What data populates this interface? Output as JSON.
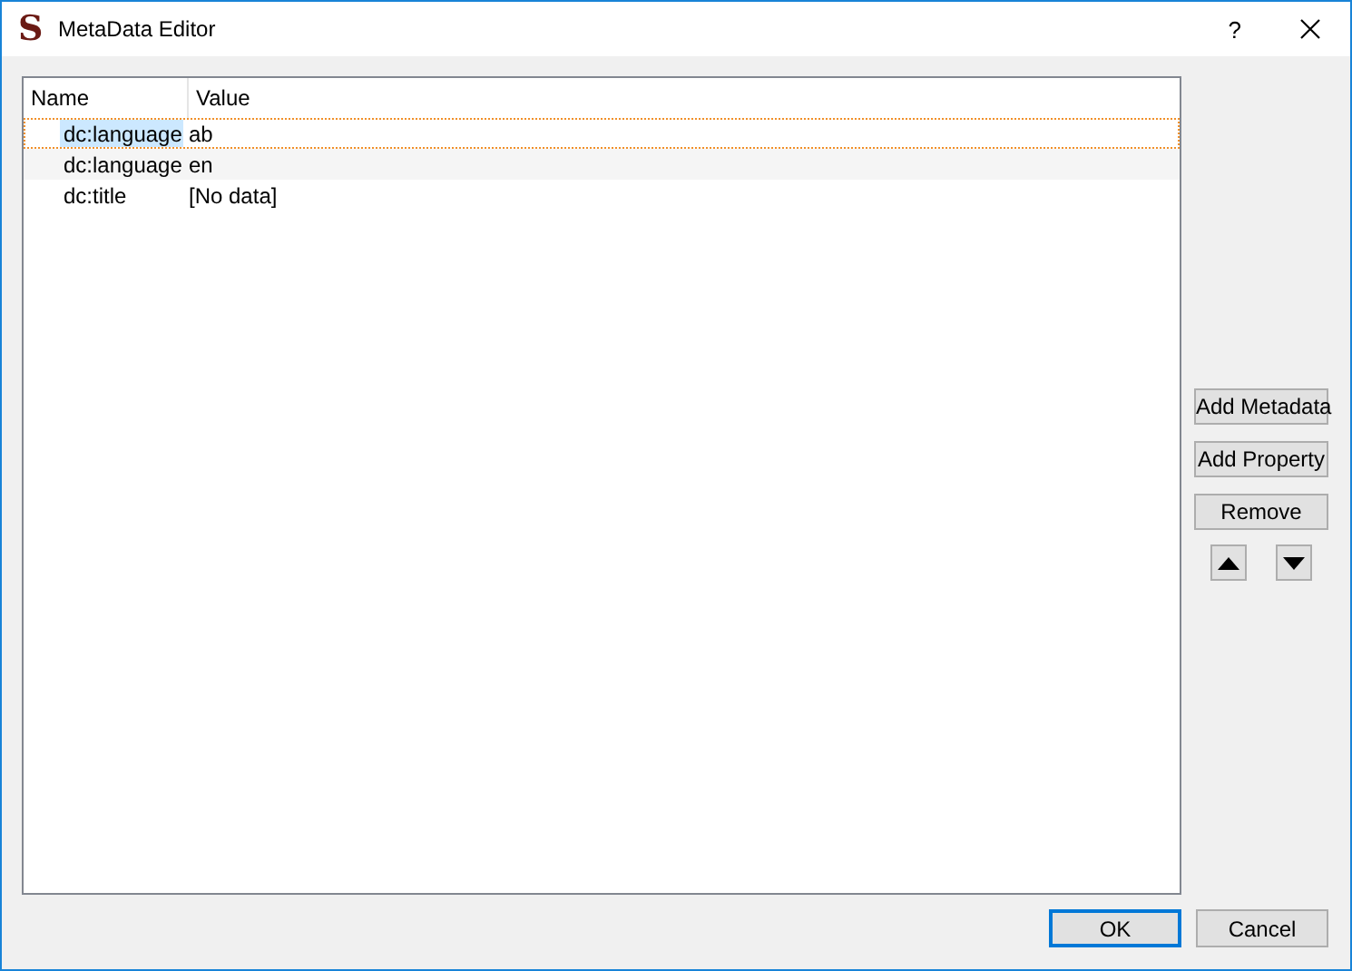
{
  "window": {
    "title": "MetaData Editor",
    "logo": "S",
    "help": "?"
  },
  "table": {
    "columns": [
      "Name",
      "Value"
    ],
    "rows": [
      {
        "name": "dc:language",
        "value": "ab",
        "selected": true
      },
      {
        "name": "dc:language",
        "value": "en",
        "selected": false
      },
      {
        "name": "dc:title",
        "value": "[No data]",
        "selected": false
      }
    ]
  },
  "side_buttons": [
    "Add Metadata",
    "Add Property",
    "Remove"
  ],
  "buttons": [
    {
      "label": "OK",
      "default": true
    },
    {
      "label": "Cancel",
      "default": false
    }
  ]
}
